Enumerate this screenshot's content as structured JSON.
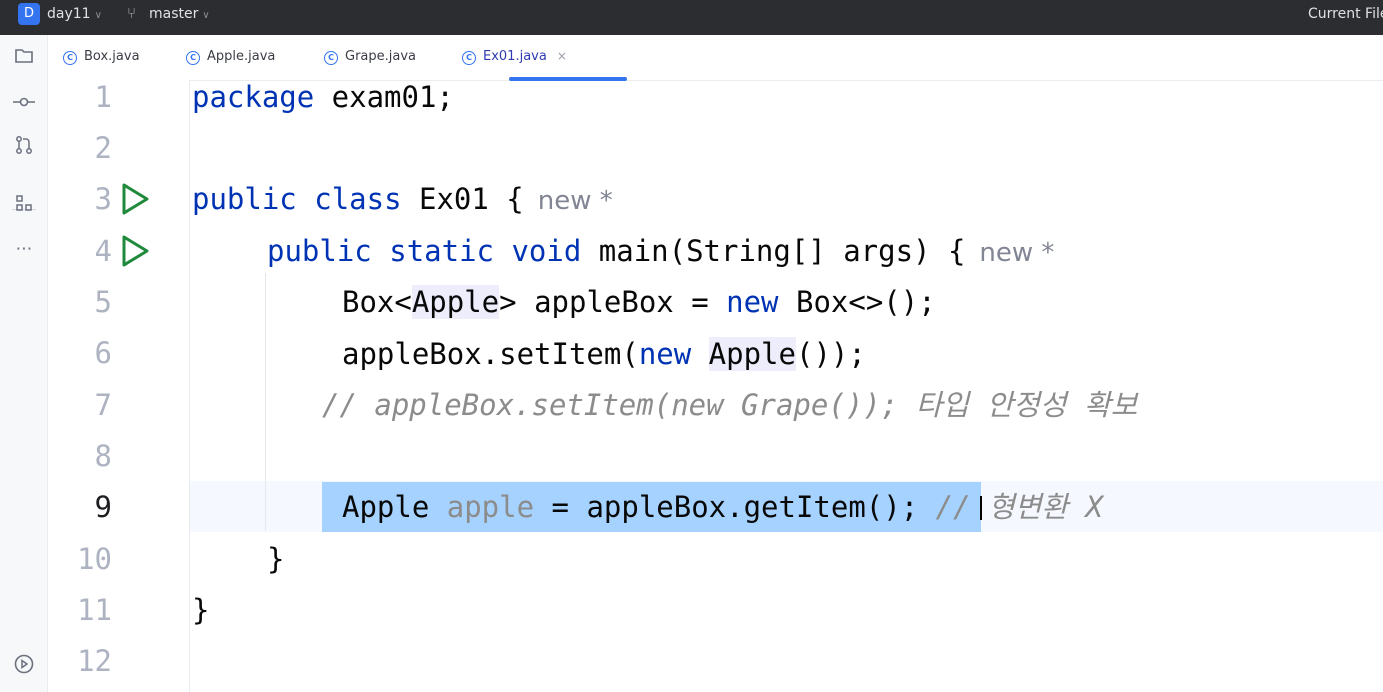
{
  "titlebar": {
    "project_badge": "D",
    "project_name": "day11",
    "branch": "master",
    "current_file": "Current File"
  },
  "tabs": [
    {
      "label": "Box.java"
    },
    {
      "label": "Apple.java"
    },
    {
      "label": "Grape.java"
    },
    {
      "label": "Ex01.java",
      "close": "×"
    }
  ],
  "line_numbers": [
    "1",
    "2",
    "3",
    "4",
    "5",
    "6",
    "7",
    "8",
    "9",
    "10",
    "11",
    "12"
  ],
  "code": {
    "l1": {
      "kw": "package",
      "rest": " exam01;"
    },
    "l3": {
      "kw1": "public",
      "kw2": "class",
      "rest": " Ex01 {",
      "hint": "new *"
    },
    "l4": {
      "kw1": "public",
      "kw2": "static",
      "kw3": "void",
      "rest1": " main(String[] args) {",
      "hint": "new *"
    },
    "l5": {
      "t1": "Box<",
      "t2": "Apple",
      "t3": "> appleBox = ",
      "kw": "new",
      "t4": " Box<>();"
    },
    "l6": {
      "t1": "appleBox.setItem(",
      "kw": "new",
      "t2": " ",
      "t3": "Apple",
      "t4": "());"
    },
    "l7": {
      "comment": "// appleBox.setItem(new Grape()); 타입 안정성 확보"
    },
    "l9": {
      "t1": "Apple ",
      "unused": "apple",
      "t2": " = appleBox.getItem(); ",
      "comment": "// 형변환 X"
    },
    "l10": {
      "t": "}"
    },
    "l11": {
      "t": "}"
    }
  },
  "icons": {
    "project_tool": "folder-icon",
    "commit_tool": "commit-icon",
    "pull_requests_tool": "pull-request-icon",
    "structure_tool": "structure-icon",
    "more_tools": "more-icon",
    "services_tool": "run-services-icon",
    "run_gutter": "run-icon"
  },
  "colors": {
    "keyword": "#0033b3",
    "comment": "#8c8c8c",
    "selection": "#a6d2ff",
    "run_icon": "#208a3c",
    "accent": "#3574f0"
  }
}
